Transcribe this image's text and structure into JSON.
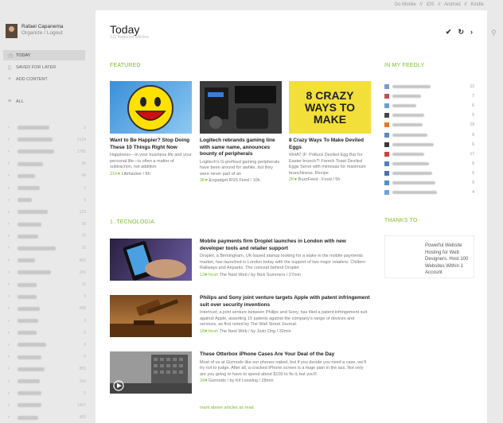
{
  "topbar": {
    "go_mobile": "Go Mobile",
    "ios": "iOS",
    "android": "Android",
    "kindle": "Kindle",
    "sep": "//"
  },
  "user": {
    "name": "Rafael Capanema",
    "links": "Organize / Logout"
  },
  "nav": [
    {
      "label": "TODAY",
      "icon": "clock-icon"
    },
    {
      "label": "SAVED FOR LATER",
      "icon": "bookmark-icon"
    },
    {
      "label": "ADD CONTENT",
      "icon": "plus-icon"
    },
    {
      "label": "ALL",
      "icon": "list-icon"
    }
  ],
  "categories": [
    {
      "count": "3"
    },
    {
      "count": "2134"
    },
    {
      "count": "2780"
    },
    {
      "count": "36"
    },
    {
      "count": "49"
    },
    {
      "count": "3"
    },
    {
      "count": "5"
    },
    {
      "count": "123"
    },
    {
      "count": "36"
    },
    {
      "count": "75"
    },
    {
      "count": "16"
    },
    {
      "count": "665"
    },
    {
      "count": "236"
    },
    {
      "count": "11"
    },
    {
      "count": "5"
    },
    {
      "count": "688"
    },
    {
      "count": "3"
    },
    {
      "count": "0"
    },
    {
      "count": "0"
    },
    {
      "count": "0"
    },
    {
      "count": "855"
    },
    {
      "count": "166"
    },
    {
      "count": "0"
    },
    {
      "count": "1667"
    },
    {
      "count": "430"
    },
    {
      "count": "0"
    }
  ],
  "main": {
    "title": "Today",
    "subtitle": "111 featured articles",
    "toolbar": {
      "check": "✔",
      "refresh": "↻",
      "next": "›"
    }
  },
  "featured_label": "FEATURED",
  "featured": [
    {
      "title": "Want to Be Happier? Stop Doing These 10 Things Right Now",
      "desc": "Happiness—in your business life and your personal life—is often a matter of subtraction, not addition",
      "count": "21K",
      "source": "Lifehacker / 8h"
    },
    {
      "title": "Logitech rebrands gaming line with same name, announces bounty of peripherals",
      "desc": "Logitech's G-prefixed gaming peripherals have been around for awhile, but they were never part of an",
      "count": "3K",
      "source": "Engadget RSS Feed / 10h"
    },
    {
      "title": "8 Crazy Ways To Make Deviled Eggs",
      "desc": "WHAT IF: Potluck Deviled Egg Bar for Easter brunch?! French Toast Deviled Eggs Serve with mimosas for maximum brunchiness. Recipe",
      "count": "2K",
      "source": "BuzzFeed - Food / 5h",
      "thumb_text": "8 CRAZY WAYS TO MAKE"
    }
  ],
  "section_label": "1. TECNOLOGIA",
  "articles": [
    {
      "title": "Mobile payments firm Droplet launches in London with new developer tools and retailer support",
      "desc": "Droplet, a Birmingham, UK-based startup looking for a stake in the mobile payments market, has launched in London today with the support of two major retailers: Chiltern Railways and Airparks. The concept behind Droplet",
      "count": "12",
      "fresh": "fresh",
      "source": "The Next Web / by Nick Summers / 27min"
    },
    {
      "title": "Philips and Sony joint venture targets Apple with patent infringement suit over security inventions",
      "desc": "Interlrust, a joint venture between Philips and Sony, has filed a patent infringement suit against Apple, asserting 15 patents against the company's range of devices and services, as first noted by The Wall Street Journal.",
      "count": "18",
      "fresh": "fresh",
      "source": "The Next Web / by Josh Ong / 32min"
    },
    {
      "title": "These Otterbox iPhone Cases Are Your Deal of the Day",
      "desc": "Most of us at Gizmodo like our phones naked, but if you decide you need a case, we'll try not to judge. After all, a cracked iPhone screen is a huge pain in the ass. Not only are you going to have to spend about $100 to fix it, but you'll",
      "count": "34",
      "fresh": "",
      "source": "Gizmodo / by Kif Leswing / 28min"
    }
  ],
  "mark_read": "mark above articles as read",
  "my_feedly_label": "IN MY FEEDLY",
  "my_feedly": [
    {
      "count": "13"
    },
    {
      "count": "7"
    },
    {
      "count": "6"
    },
    {
      "count": "5"
    },
    {
      "count": "19"
    },
    {
      "count": "6"
    },
    {
      "count": "6"
    },
    {
      "count": "17"
    },
    {
      "count": "5"
    },
    {
      "count": "6"
    },
    {
      "count": "5"
    },
    {
      "count": "4"
    }
  ],
  "thanks_label": "THANKS TO",
  "thanks_text": "Powerful Website Hosting for Web Designers. Host 100 Websites Within 1 Account",
  "colors": {
    "accent": "#7dbb2e",
    "sidebar_bg": "#e9e9e9"
  }
}
